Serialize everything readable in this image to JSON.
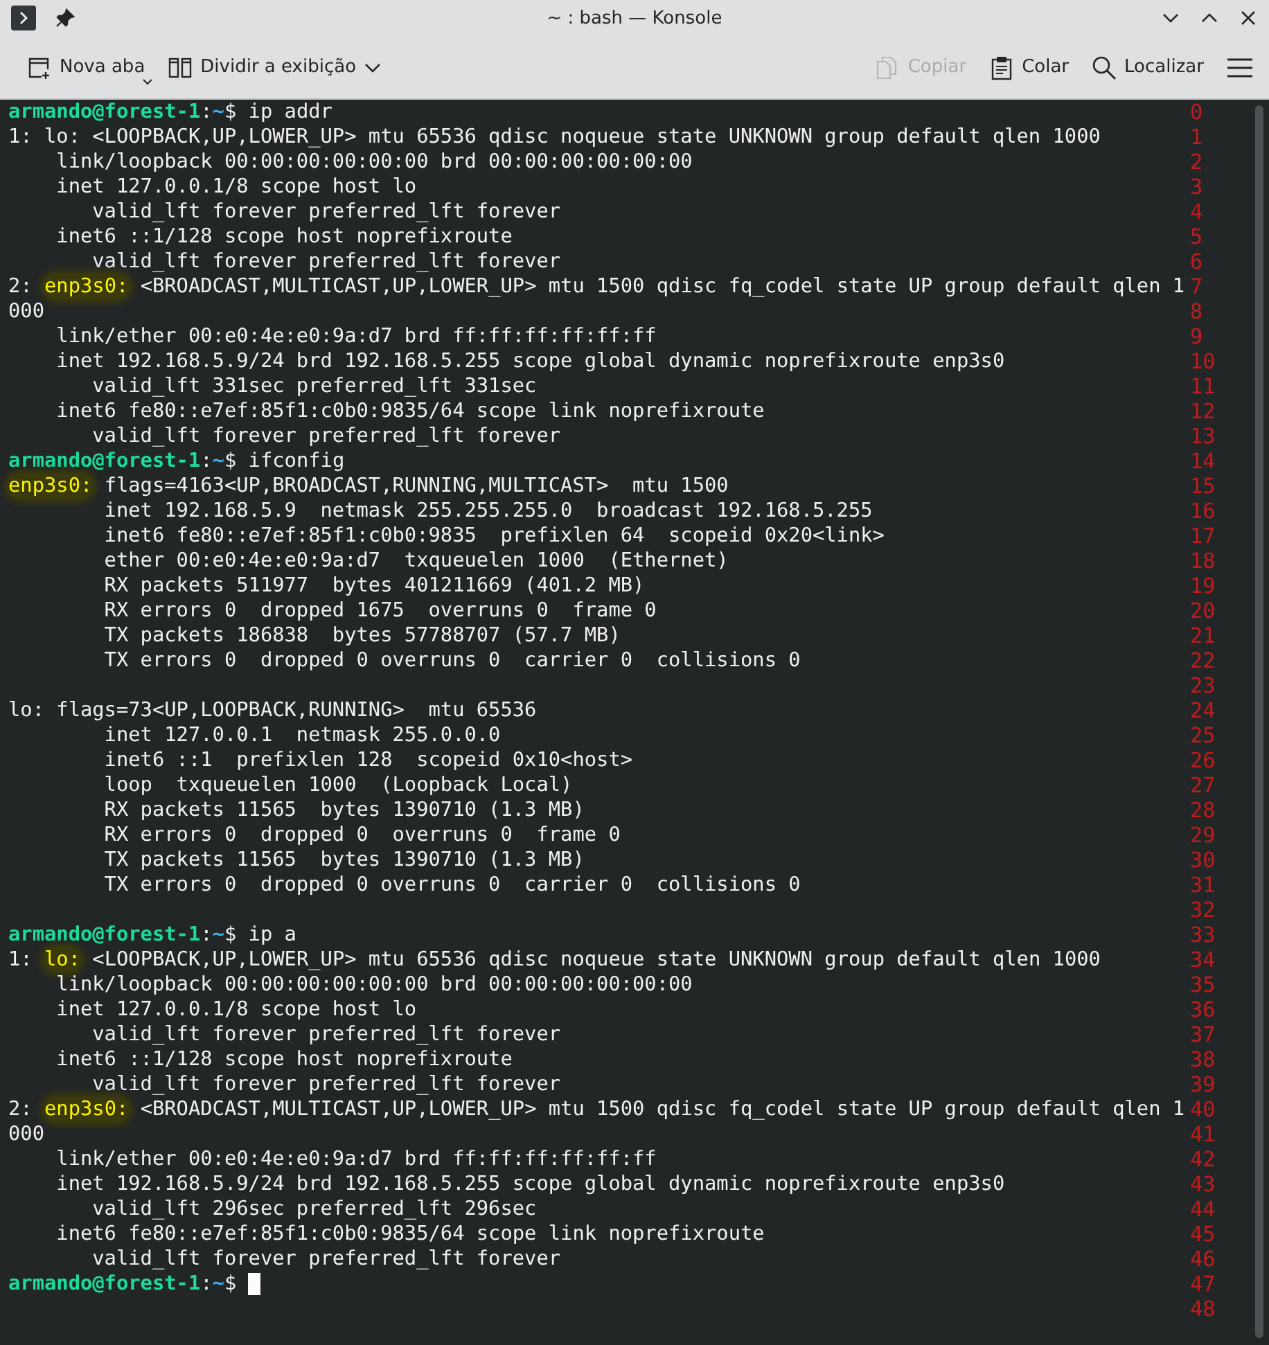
{
  "window": {
    "title": "~ : bash — Konsole"
  },
  "toolbar": {
    "left": [
      {
        "kind": "new-tab",
        "label": "Nova aba",
        "disabled": false
      },
      {
        "kind": "split",
        "label": "Dividir a exibição",
        "disabled": false
      }
    ],
    "right": [
      {
        "kind": "copy",
        "label": "Copiar",
        "disabled": true
      },
      {
        "kind": "paste",
        "label": "Colar",
        "disabled": false
      },
      {
        "kind": "find",
        "label": "Localizar",
        "disabled": false
      },
      {
        "kind": "menu",
        "disabled": false
      }
    ]
  },
  "terminal": {
    "cursor": true,
    "lines": [
      {
        "number": "0",
        "segments": [
          {
            "kind": "user",
            "text": "armando@forest-1"
          },
          {
            "kind": "plain",
            "text": ":"
          },
          {
            "kind": "path",
            "text": "~"
          },
          {
            "kind": "plain",
            "text": "$ ip addr"
          }
        ]
      },
      {
        "number": "1",
        "segments": [
          {
            "kind": "plain",
            "text": "1: lo: <LOOPBACK,UP,LOWER_UP> mtu 65536 qdisc noqueue state UNKNOWN group default qlen 1000"
          }
        ]
      },
      {
        "number": "2",
        "segments": [
          {
            "kind": "plain",
            "text": "    link/loopback 00:00:00:00:00:00 brd 00:00:00:00:00:00"
          }
        ]
      },
      {
        "number": "3",
        "segments": [
          {
            "kind": "plain",
            "text": "    inet 127.0.0.1/8 scope host lo"
          }
        ]
      },
      {
        "number": "4",
        "segments": [
          {
            "kind": "plain",
            "text": "       valid_lft forever preferred_lft forever"
          }
        ]
      },
      {
        "number": "5",
        "segments": [
          {
            "kind": "plain",
            "text": "    inet6 ::1/128 scope host noprefixroute"
          }
        ]
      },
      {
        "number": "6",
        "segments": [
          {
            "kind": "plain",
            "text": "       valid_lft forever preferred_lft forever"
          }
        ]
      },
      {
        "number": "7",
        "segments": [
          {
            "kind": "plain",
            "text": "2: "
          },
          {
            "kind": "highlight",
            "text": "enp3s0:"
          },
          {
            "kind": "plain",
            "text": " <BROADCAST,MULTICAST,UP,LOWER_UP> mtu 1500 qdisc fq_codel state UP group default qlen 1"
          }
        ]
      },
      {
        "number": "8",
        "segments": [
          {
            "kind": "plain",
            "text": "000"
          }
        ]
      },
      {
        "number": "9",
        "segments": [
          {
            "kind": "plain",
            "text": "    link/ether 00:e0:4e:e0:9a:d7 brd ff:ff:ff:ff:ff:ff"
          }
        ]
      },
      {
        "number": "10",
        "segments": [
          {
            "kind": "plain",
            "text": "    inet 192.168.5.9/24 brd 192.168.5.255 scope global dynamic noprefixroute enp3s0"
          }
        ]
      },
      {
        "number": "11",
        "segments": [
          {
            "kind": "plain",
            "text": "       valid_lft 331sec preferred_lft 331sec"
          }
        ]
      },
      {
        "number": "12",
        "segments": [
          {
            "kind": "plain",
            "text": "    inet6 fe80::e7ef:85f1:c0b0:9835/64 scope link noprefixroute"
          }
        ]
      },
      {
        "number": "13",
        "segments": [
          {
            "kind": "plain",
            "text": "       valid_lft forever preferred_lft forever"
          }
        ]
      },
      {
        "number": "14",
        "segments": [
          {
            "kind": "user",
            "text": "armando@forest-1"
          },
          {
            "kind": "plain",
            "text": ":"
          },
          {
            "kind": "path",
            "text": "~"
          },
          {
            "kind": "plain",
            "text": "$ ifconfig"
          }
        ]
      },
      {
        "number": "15",
        "segments": [
          {
            "kind": "highlight",
            "text": "enp3s0:"
          },
          {
            "kind": "plain",
            "text": " flags=4163<UP,BROADCAST,RUNNING,MULTICAST>  mtu 1500"
          }
        ]
      },
      {
        "number": "16",
        "segments": [
          {
            "kind": "plain",
            "text": "        inet 192.168.5.9  netmask 255.255.255.0  broadcast 192.168.5.255"
          }
        ]
      },
      {
        "number": "17",
        "segments": [
          {
            "kind": "plain",
            "text": "        inet6 fe80::e7ef:85f1:c0b0:9835  prefixlen 64  scopeid 0x20<link>"
          }
        ]
      },
      {
        "number": "18",
        "segments": [
          {
            "kind": "plain",
            "text": "        ether 00:e0:4e:e0:9a:d7  txqueuelen 1000  (Ethernet)"
          }
        ]
      },
      {
        "number": "19",
        "segments": [
          {
            "kind": "plain",
            "text": "        RX packets 511977  bytes 401211669 (401.2 MB)"
          }
        ]
      },
      {
        "number": "20",
        "segments": [
          {
            "kind": "plain",
            "text": "        RX errors 0  dropped 1675  overruns 0  frame 0"
          }
        ]
      },
      {
        "number": "21",
        "segments": [
          {
            "kind": "plain",
            "text": "        TX packets 186838  bytes 57788707 (57.7 MB)"
          }
        ]
      },
      {
        "number": "22",
        "segments": [
          {
            "kind": "plain",
            "text": "        TX errors 0  dropped 0 overruns 0  carrier 0  collisions 0"
          }
        ]
      },
      {
        "number": "23"
      },
      {
        "number": "24",
        "segments": [
          {
            "kind": "plain",
            "text": "lo: flags=73<UP,LOOPBACK,RUNNING>  mtu 65536"
          }
        ]
      },
      {
        "number": "25",
        "segments": [
          {
            "kind": "plain",
            "text": "        inet 127.0.0.1  netmask 255.0.0.0"
          }
        ]
      },
      {
        "number": "26",
        "segments": [
          {
            "kind": "plain",
            "text": "        inet6 ::1  prefixlen 128  scopeid 0x10<host>"
          }
        ]
      },
      {
        "number": "27",
        "segments": [
          {
            "kind": "plain",
            "text": "        loop  txqueuelen 1000  (Loopback Local)"
          }
        ]
      },
      {
        "number": "28",
        "segments": [
          {
            "kind": "plain",
            "text": "        RX packets 11565  bytes 1390710 (1.3 MB)"
          }
        ]
      },
      {
        "number": "29",
        "segments": [
          {
            "kind": "plain",
            "text": "        RX errors 0  dropped 0  overruns 0  frame 0"
          }
        ]
      },
      {
        "number": "30",
        "segments": [
          {
            "kind": "plain",
            "text": "        TX packets 11565  bytes 1390710 (1.3 MB)"
          }
        ]
      },
      {
        "number": "31",
        "segments": [
          {
            "kind": "plain",
            "text": "        TX errors 0  dropped 0 overruns 0  carrier 0  collisions 0"
          }
        ]
      },
      {
        "number": "32"
      },
      {
        "number": "33",
        "segments": [
          {
            "kind": "user",
            "text": "armando@forest-1"
          },
          {
            "kind": "plain",
            "text": ":"
          },
          {
            "kind": "path",
            "text": "~"
          },
          {
            "kind": "plain",
            "text": "$ ip a"
          }
        ]
      },
      {
        "number": "34",
        "segments": [
          {
            "kind": "plain",
            "text": "1: "
          },
          {
            "kind": "highlight",
            "text": "lo:"
          },
          {
            "kind": "plain",
            "text": " <LOOPBACK,UP,LOWER_UP> mtu 65536 qdisc noqueue state UNKNOWN group default qlen 1000"
          }
        ]
      },
      {
        "number": "35",
        "segments": [
          {
            "kind": "plain",
            "text": "    link/loopback 00:00:00:00:00:00 brd 00:00:00:00:00:00"
          }
        ]
      },
      {
        "number": "36",
        "segments": [
          {
            "kind": "plain",
            "text": "    inet 127.0.0.1/8 scope host lo"
          }
        ]
      },
      {
        "number": "37",
        "segments": [
          {
            "kind": "plain",
            "text": "       valid_lft forever preferred_lft forever"
          }
        ]
      },
      {
        "number": "38",
        "segments": [
          {
            "kind": "plain",
            "text": "    inet6 ::1/128 scope host noprefixroute"
          }
        ]
      },
      {
        "number": "39",
        "segments": [
          {
            "kind": "plain",
            "text": "       valid_lft forever preferred_lft forever"
          }
        ]
      },
      {
        "number": "40",
        "segments": [
          {
            "kind": "plain",
            "text": "2: "
          },
          {
            "kind": "highlight",
            "text": "enp3s0:"
          },
          {
            "kind": "plain",
            "text": " <BROADCAST,MULTICAST,UP,LOWER_UP> mtu 1500 qdisc fq_codel state UP group default qlen 1"
          }
        ]
      },
      {
        "number": "41",
        "segments": [
          {
            "kind": "plain",
            "text": "000"
          }
        ]
      },
      {
        "number": "42",
        "segments": [
          {
            "kind": "plain",
            "text": "    link/ether 00:e0:4e:e0:9a:d7 brd ff:ff:ff:ff:ff:ff"
          }
        ]
      },
      {
        "number": "43",
        "segments": [
          {
            "kind": "plain",
            "text": "    inet 192.168.5.9/24 brd 192.168.5.255 scope global dynamic noprefixroute enp3s0"
          }
        ]
      },
      {
        "number": "44",
        "segments": [
          {
            "kind": "plain",
            "text": "       valid_lft 296sec preferred_lft 296sec"
          }
        ]
      },
      {
        "number": "45",
        "segments": [
          {
            "kind": "plain",
            "text": "    inet6 fe80::e7ef:85f1:c0b0:9835/64 scope link noprefixroute"
          }
        ]
      },
      {
        "number": "46",
        "segments": [
          {
            "kind": "plain",
            "text": "       valid_lft forever preferred_lft forever"
          }
        ]
      },
      {
        "number": "47",
        "segments": [
          {
            "kind": "user",
            "text": "armando@forest-1"
          },
          {
            "kind": "plain",
            "text": ":"
          },
          {
            "kind": "path",
            "text": "~"
          },
          {
            "kind": "plain",
            "text": "$ "
          }
        ]
      },
      {
        "number": "48"
      }
    ]
  }
}
